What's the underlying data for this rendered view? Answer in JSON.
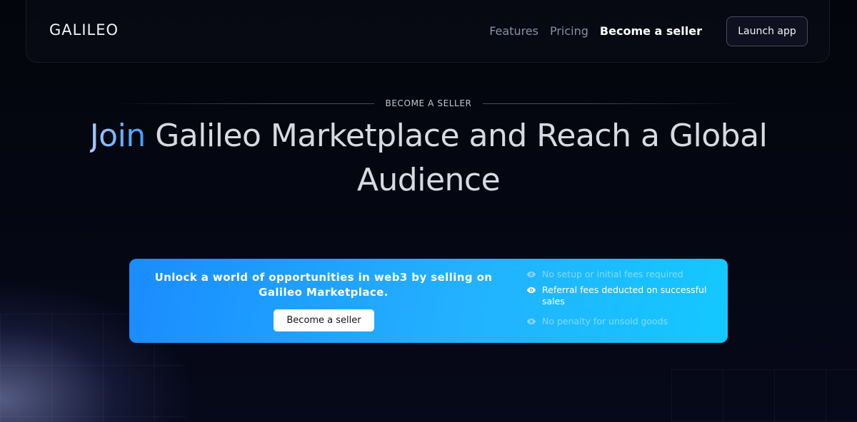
{
  "nav": {
    "logo": "GALILEO",
    "links": [
      {
        "label": "Features",
        "active": false
      },
      {
        "label": "Pricing",
        "active": false
      },
      {
        "label": "Become a seller",
        "active": true
      }
    ],
    "launch_label": "Launch app"
  },
  "hero": {
    "eyebrow": "BECOME A SELLER",
    "headline_accent": "Join",
    "headline_rest": " Galileo Marketplace and Reach a Global Audience"
  },
  "cta": {
    "text": "Unlock a world of opportunities in web3 by selling on Galileo Marketplace.",
    "button_label": "Become a seller",
    "features": [
      {
        "label": "No setup or initial fees required",
        "dim": true,
        "icon": "eye-icon"
      },
      {
        "label": "Referral fees deducted on successful sales",
        "dim": false,
        "icon": "eye-icon"
      },
      {
        "label": "No penalty for unsold goods",
        "dim": true,
        "icon": "eye-icon"
      }
    ]
  },
  "colors": {
    "background": "#04060f",
    "accent_blue": "#3f9dff",
    "card_gradient_start": "#1a8cff",
    "card_gradient_end": "#14c8ff"
  }
}
